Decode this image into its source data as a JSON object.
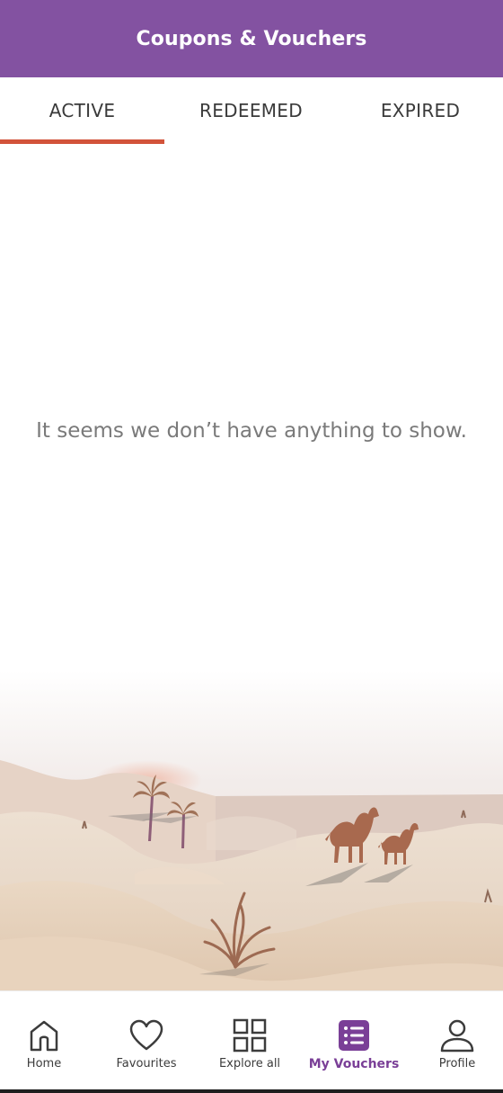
{
  "header": {
    "title": "Coupons & Vouchers"
  },
  "tabs": [
    {
      "label": "ACTIVE",
      "selected": true
    },
    {
      "label": "REDEEMED",
      "selected": false
    },
    {
      "label": "EXPIRED",
      "selected": false
    }
  ],
  "empty_state": {
    "message": "It seems we don’t have anything to show."
  },
  "bottom_nav": [
    {
      "label": "Home",
      "icon": "home-icon"
    },
    {
      "label": "Favourites",
      "icon": "heart-icon"
    },
    {
      "label": "Explore all",
      "icon": "grid-icon"
    },
    {
      "label": "My Vouchers",
      "icon": "list-icon",
      "active": true
    },
    {
      "label": "Profile",
      "icon": "profile-icon"
    }
  ],
  "colors": {
    "brand": "#8352a1",
    "tab_indicator": "#d2533a",
    "active_nav": "#7a3f97"
  }
}
